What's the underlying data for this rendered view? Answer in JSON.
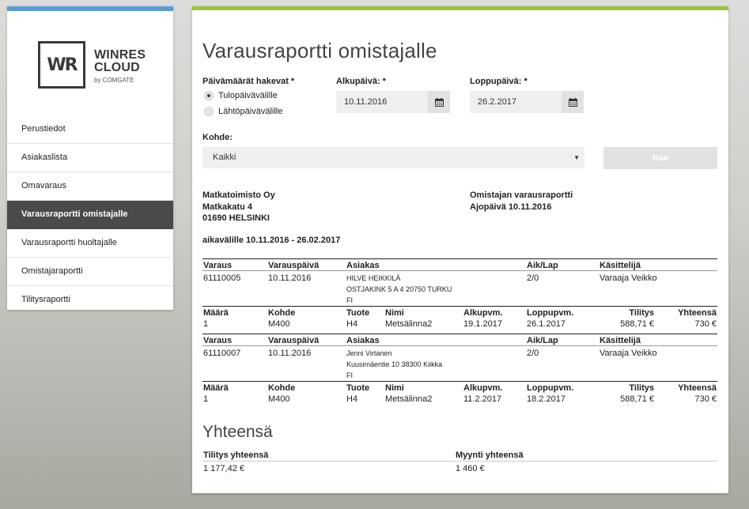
{
  "logo": {
    "mark": "WR",
    "line1": "WINRES",
    "line2": "CLOUD",
    "sub": "by COMGATE"
  },
  "colors": {
    "sidebar_accent": "#5b9bd5",
    "main_accent": "#9bc43b",
    "active_nav": "#4a4a4a"
  },
  "nav": [
    {
      "label": "Perustiedot",
      "active": false
    },
    {
      "label": "Asiakaslista",
      "active": false
    },
    {
      "label": "Omavaraus",
      "active": false
    },
    {
      "label": "Varausraportti omistajalle",
      "active": true
    },
    {
      "label": "Varausraportti huoltajalle",
      "active": false
    },
    {
      "label": "Omistajaraportti",
      "active": false
    },
    {
      "label": "Tilitysraportti",
      "active": false
    }
  ],
  "page": {
    "title": "Varausraportti omistajalle"
  },
  "form": {
    "dates_label": "Päivämäärät hakevat *",
    "radio_arrival": "Tulopäivävälille",
    "radio_departure": "Lähtöpäivävälille",
    "start_label": "Alkupäivä: *",
    "start_value": "10.11.2016",
    "end_label": "Loppupäivä: *",
    "end_value": "26.2.2017",
    "target_label": "Kohde:",
    "target_value": "Kaikki",
    "search_button": "Hae",
    "calendar_icon": "calendar-icon"
  },
  "report": {
    "company_line1": "Matkatoimisto Oy",
    "company_line2": "Matkakatu 4",
    "company_line3": "01690 HELSINKI",
    "report_title": "Omistajan varausraportti",
    "run_date": "Ajopäivä 10.11.2016",
    "period": "aikavälille 10.11.2016 - 26.02.2017"
  },
  "table": {
    "res_headers": {
      "varaus": "Varaus",
      "varauspaiva": "Varauspäivä",
      "asiakas": "Asiakas",
      "aiklap": "Aik/Lap",
      "kasittelija": "Käsittelijä"
    },
    "item_headers": {
      "maara": "Määrä",
      "kohde": "Kohde",
      "tuote": "Tuote",
      "nimi": "Nimi",
      "alkupvm": "Alkupvm.",
      "loppupvm": "Loppupvm.",
      "tilitys": "Tilitys",
      "yhteensa": "Yhteensä"
    },
    "reservations": [
      {
        "varaus": "61110005",
        "varauspaiva": "10.11.2016",
        "customer1": "HILVE HEIKKILÄ",
        "customer2": "OSTJAKINK 5 A 4 20750 TURKU",
        "customer3": "FI",
        "aiklap": "2/0",
        "kasittelija": "Varaaja Veikko",
        "maara": "1",
        "kohde": "M400",
        "tuote": "H4",
        "nimi": "Metsälinna2",
        "alkupvm": "19.1.2017",
        "loppupvm": "26.1.2017",
        "tilitys": "588,71 €",
        "yhteensa": "730 €"
      },
      {
        "varaus": "61110007",
        "varauspaiva": "10.11.2016",
        "customer1": "Jenni Virtanen",
        "customer2": "Kuusimäentie 10 38300 Kiikka",
        "customer3": "FI",
        "aiklap": "2/0",
        "kasittelija": "Varaaja Veikko",
        "maara": "1",
        "kohde": "M400",
        "tuote": "H4",
        "nimi": "Metsälinna2",
        "alkupvm": "11.2.2017",
        "loppupvm": "18.2.2017",
        "tilitys": "588,71 €",
        "yhteensa": "730 €"
      }
    ]
  },
  "summary": {
    "title": "Yhteensä",
    "tilitys_label": "Tilitys yhteensä",
    "tilitys_value": "1 177,42 €",
    "myynti_label": "Myynti yhteensä",
    "myynti_value": "1 460 €"
  }
}
